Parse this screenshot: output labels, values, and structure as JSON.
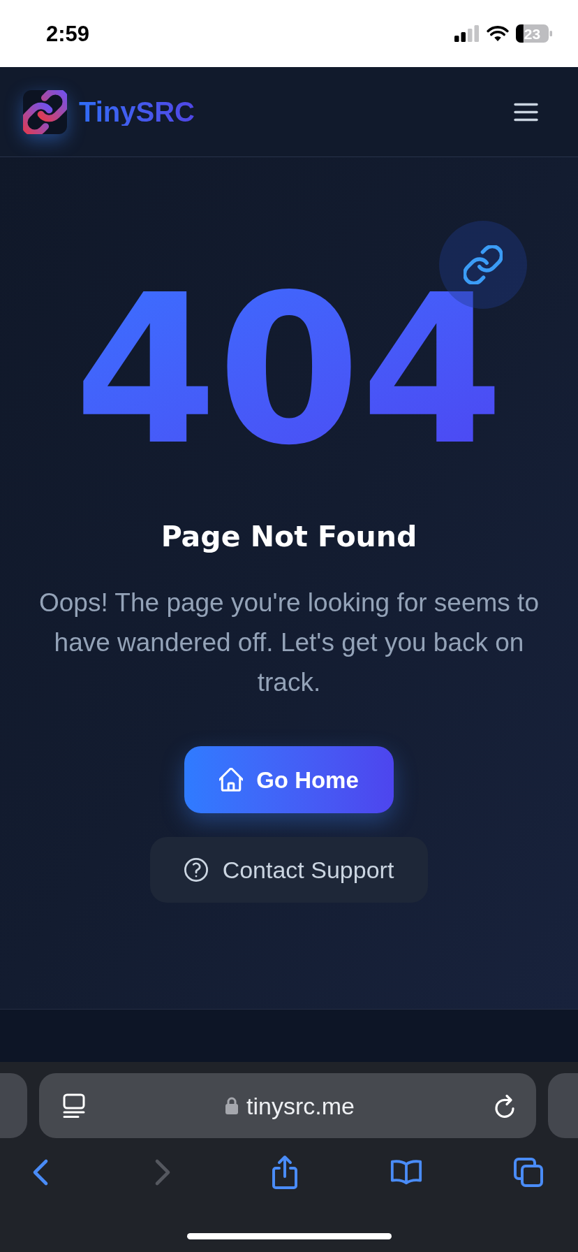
{
  "status_bar": {
    "time": "2:59",
    "battery": "23"
  },
  "header": {
    "brand": "TinySRC"
  },
  "error": {
    "code": "404",
    "title": "Page Not Found",
    "message": "Oops! The page you're looking for seems to have wandered off. Let's get you back on track."
  },
  "actions": [
    {
      "kind": "primary",
      "label": "Go Home"
    },
    {
      "kind": "secondary",
      "label": "Contact Support"
    }
  ],
  "browser": {
    "url": "tinysrc.me",
    "toolbar": [
      {
        "kind": "back",
        "disabled": false
      },
      {
        "kind": "forward",
        "disabled": true
      },
      {
        "kind": "share",
        "disabled": false
      },
      {
        "kind": "bookmarks",
        "disabled": false
      },
      {
        "kind": "tabs",
        "disabled": false
      }
    ]
  }
}
